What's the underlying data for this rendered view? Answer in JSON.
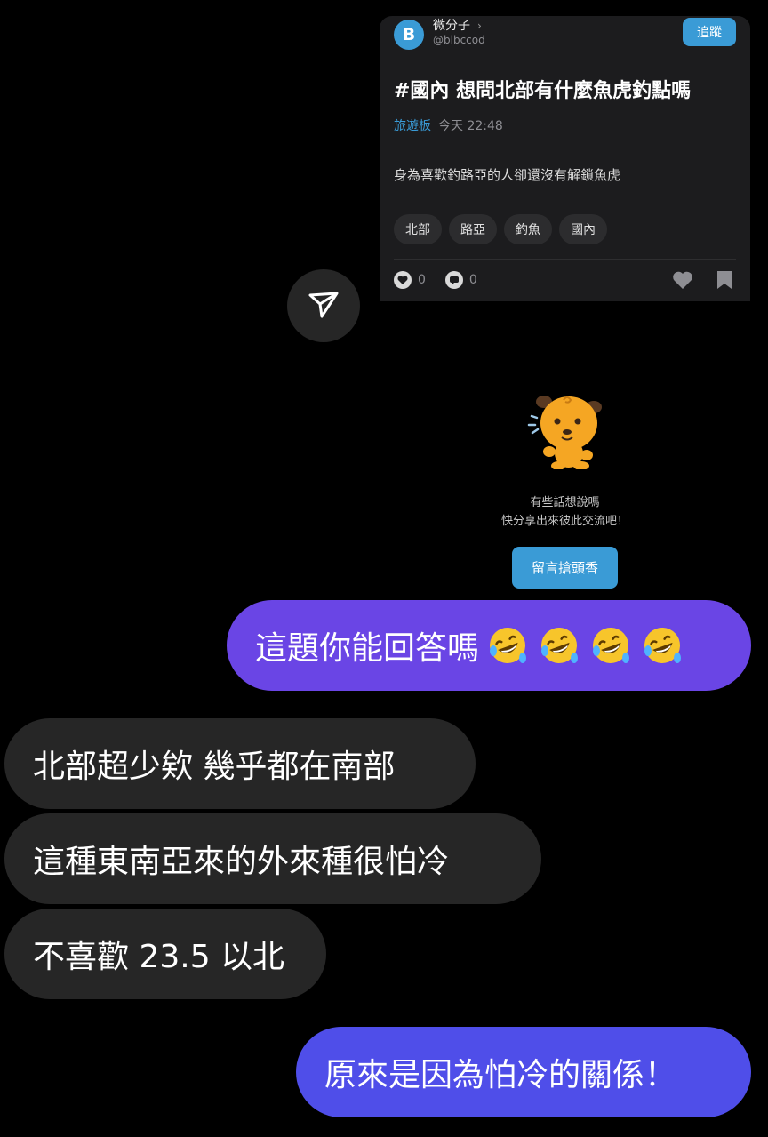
{
  "shared_post": {
    "avatar_letter": "B",
    "author": "微分子",
    "author_chevron": "›",
    "handle": "@blbccod",
    "follow_label": "追蹤",
    "title": "#國內 想問北部有什麼魚虎釣點嗎",
    "board": "旅遊板",
    "time": "今天 22:48",
    "body": "身為喜歡釣路亞的人卻還沒有解鎖魚虎",
    "tags": [
      "北部",
      "路亞",
      "釣魚",
      "國內"
    ],
    "like_count": "0",
    "comment_count": "0",
    "empty_line1": "有些話想說嗎",
    "empty_line2": "快分享出來彼此交流吧！",
    "comment_button": "留言搶頭香"
  },
  "messages": [
    {
      "from": "me",
      "text": "這題你能回答嗎",
      "emoji_count": 4
    },
    {
      "from": "them",
      "text": "北部超少欸 幾乎都在南部"
    },
    {
      "from": "them",
      "text": "這種東南亞來的外來種很怕冷"
    },
    {
      "from": "them",
      "text": "不喜歡 23.5 以北"
    },
    {
      "from": "me",
      "text": "原來是因為怕冷的關係！"
    }
  ],
  "colors": {
    "accent_blue": "#3a9bd6",
    "sent_bubble": "#6a45e5",
    "sent_bubble_2": "#4f4ee9",
    "received_bubble": "#262626"
  },
  "icons": [
    "send-icon",
    "heart-icon",
    "comment-icon",
    "bookmark-icon",
    "laughing-emoji-icon"
  ]
}
